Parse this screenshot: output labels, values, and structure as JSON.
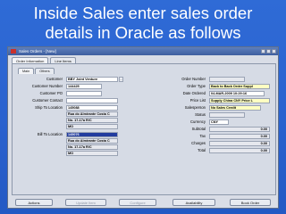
{
  "slide": {
    "title_line1": "Inside Sales enter sales order",
    "title_line2": "details in Oracle as follows"
  },
  "window": {
    "title": "Sales Orders - [New]"
  },
  "tabs": {
    "order_information": "Order Information",
    "line_items": "Line Items"
  },
  "subtabs": {
    "main": "Main",
    "others": "Others"
  },
  "left_form": {
    "customer_label": "Customer",
    "customer_value": "BBY Joint Venture",
    "customer_number_label": "Customer Number",
    "customer_number_value": "144425",
    "customer_po_label": "Customer PO",
    "customer_po_value": "",
    "customer_contact_label": "Customer Contact",
    "customer_contact_value": "",
    "ship_to_label": "Ship To Location",
    "ship_to_value": "145088",
    "ship_addr_1": "Rua do Almirante Costa C",
    "ship_addr_2": "No. 17-17a R/C",
    "ship_addr_3": "MO",
    "bill_to_label": "Bill To Location",
    "bill_to_value": "145076",
    "bill_addr_1": "Rua do Almirante Costa C",
    "bill_addr_2": "No. 17-17a R/C",
    "bill_addr_3": "MO"
  },
  "right_form": {
    "order_number_label": "Order Number",
    "order_number_value": "",
    "order_type_label": "Order Type",
    "order_type_value": "Back to Back Order Suppl",
    "date_ordered_label": "Date Ordered",
    "date_ordered_value": "04-MAR-2009 10:29:16",
    "price_list_label": "Price List",
    "price_list_value": "Supply China CNY Price L",
    "salesperson_label": "Salesperson",
    "salesperson_value": "No Sales Credit",
    "status_label": "Status",
    "status_value": "",
    "currency_label": "Currency",
    "currency_value": "CNY",
    "subtotal_label": "Subtotal",
    "subtotal_value": "0.00",
    "tax_label": "Tax",
    "tax_value": "0.00",
    "charges_label": "Charges",
    "charges_value": "0.00",
    "total_label": "Total",
    "total_value": "0.00"
  },
  "buttons": {
    "actions": "Actions",
    "update_item": "Update Item",
    "configure": "Configure",
    "availability": "Availability",
    "book_order": "Book Order"
  }
}
